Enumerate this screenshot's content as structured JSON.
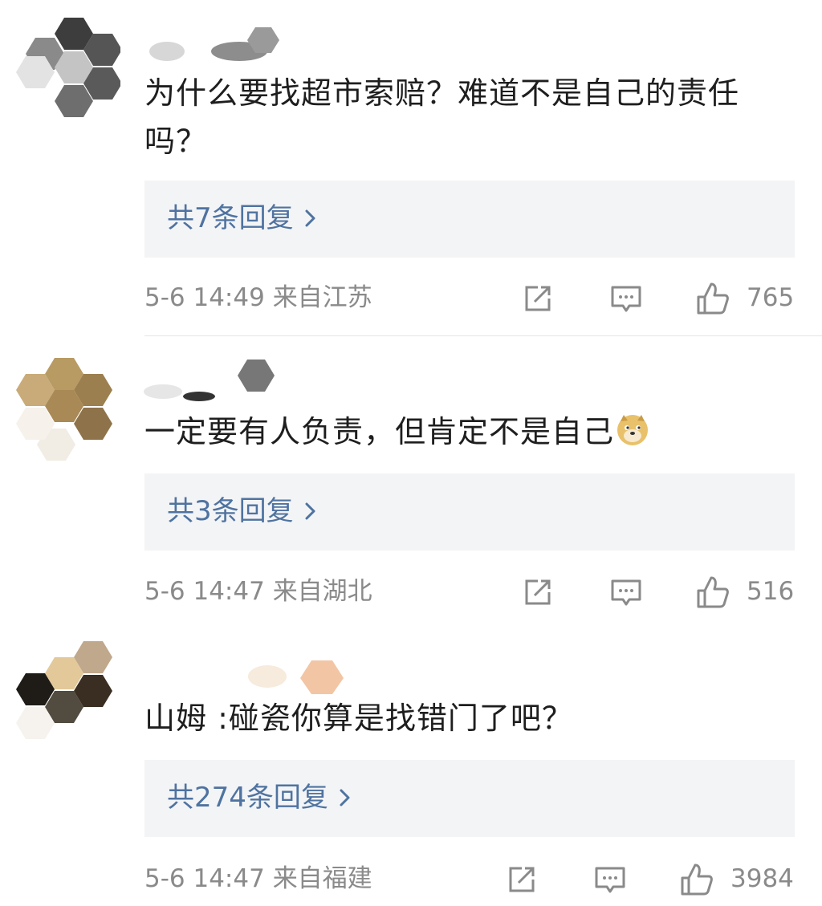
{
  "comments": [
    {
      "text": "为什么要找超市索赔？难道不是自己的责任吗？",
      "replies_label": "共7条回复",
      "time": "5-6 14:49",
      "location": "来自江苏",
      "likes": "765"
    },
    {
      "text": "一定要有人负责，但肯定不是自己",
      "replies_label": "共3条回复",
      "time": "5-6 14:47",
      "location": "来自湖北",
      "likes": "516"
    },
    {
      "text": "山姆 :碰瓷你算是找错门了吧？",
      "replies_label": "共274条回复",
      "time": "5-6 14:47",
      "location": "来自福建",
      "likes": "3984"
    }
  ],
  "icons": {
    "share": "share-icon",
    "comment": "comment-icon",
    "like": "thumbs-up-icon",
    "chevron": "chevron-right-icon",
    "emoji": "doge-emoji-icon"
  },
  "colors": {
    "link": "#4f73a0",
    "meta": "#8a8a8a",
    "reply_bg": "#f3f4f6"
  }
}
